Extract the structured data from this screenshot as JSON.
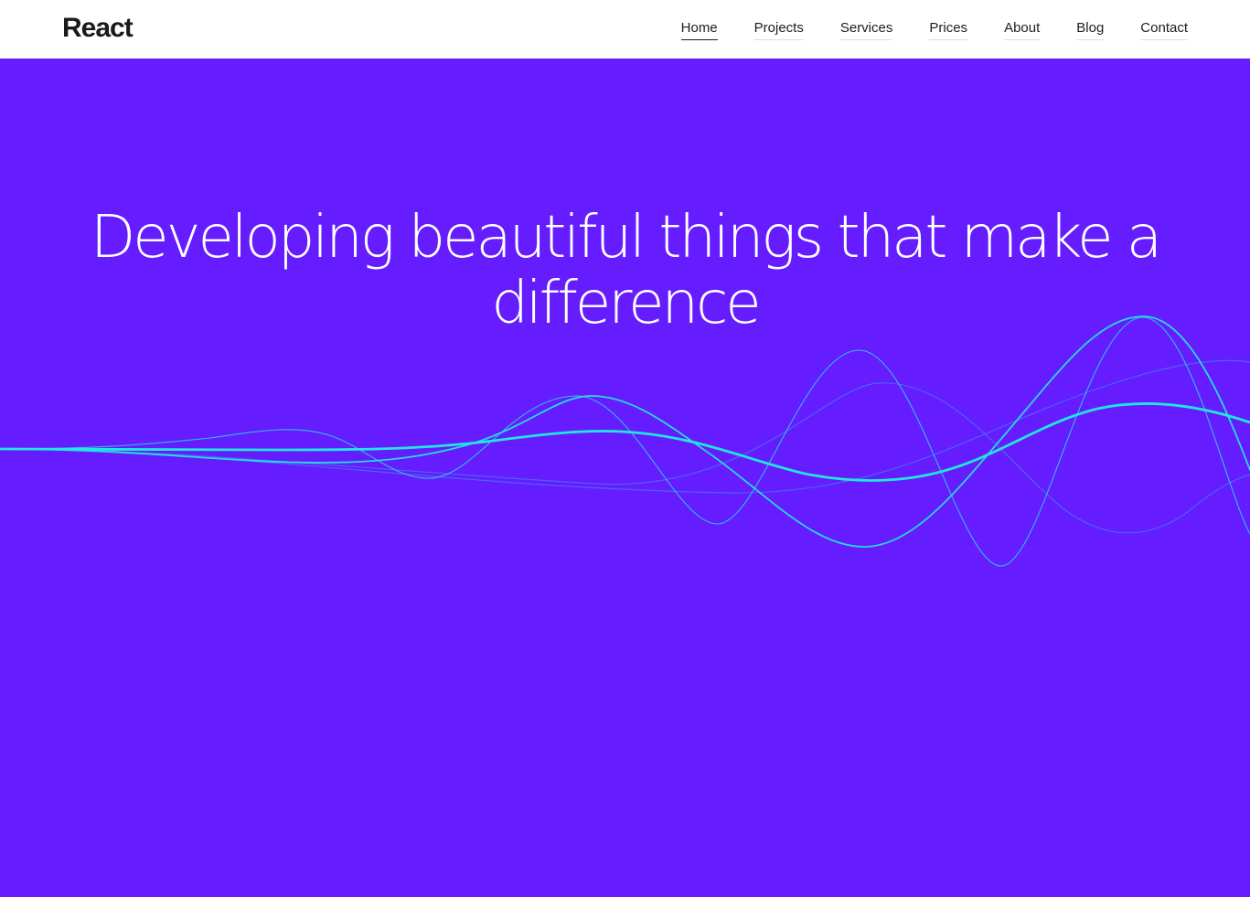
{
  "header": {
    "logo": "React",
    "nav": [
      {
        "label": "Home",
        "active": true
      },
      {
        "label": "Projects",
        "active": false
      },
      {
        "label": "Services",
        "active": false
      },
      {
        "label": "Prices",
        "active": false
      },
      {
        "label": "About",
        "active": false
      },
      {
        "label": "Blog",
        "active": false
      },
      {
        "label": "Contact",
        "active": false
      }
    ]
  },
  "hero": {
    "title": "Developing beautiful things that make a difference",
    "background_color": "#651cff",
    "text_color": "#ffffff",
    "wave_color": "#22e5e0"
  }
}
